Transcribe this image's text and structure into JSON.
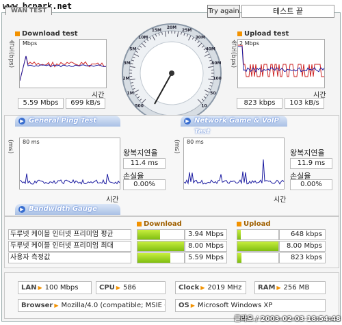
{
  "header": {
    "watermark": "www.bcpark.net",
    "wan_tab": "WAN TEST",
    "try_again": "Try again",
    "status": "테스트 끝"
  },
  "download": {
    "title": "Download test",
    "ylabel": "속도(bps)",
    "scale": "Mbps",
    "xlabel": "시간",
    "value1": "5.59 Mbps",
    "value2": "699 kB/s"
  },
  "upload": {
    "title": "Upload test",
    "ylabel": "속도(bps)",
    "scale": "2 Mbps",
    "xlabel": "시간",
    "value1": "823 kbps",
    "value2": "103 kB/s"
  },
  "gauge": {
    "ticks": [
      "500",
      "1M",
      "2M",
      "3M",
      "5M",
      "10M",
      "15M",
      "20M",
      "25M",
      "30M",
      "40M",
      "50M",
      "100",
      "50",
      "10"
    ],
    "needle_value": "5.59 Mbps"
  },
  "ping": {
    "bar_label": "General Ping Test",
    "ylabel": "(ms)",
    "scale": "80 ms",
    "xlabel": "시간",
    "rtt_label": "왕복지연율",
    "rtt_value": "11.4 ms",
    "loss_label": "손실율",
    "loss_value": "0.00%"
  },
  "game": {
    "bar_label": "Network Game & VoIP Test",
    "ylabel": "(ms)",
    "scale": "80 ms",
    "xlabel": "시간",
    "rtt_label": "왕복지연율",
    "rtt_value": "11.9 ms",
    "loss_label": "손실율",
    "loss_value": "0.00%"
  },
  "bandwidth": {
    "bar_label": "Bandwidth Gauge",
    "download_header": "Download",
    "upload_header": "Upload",
    "rows": [
      {
        "label": "두루넷 케이블 인터넷 프리미엄 평균",
        "dl_value": "3.94 Mbps",
        "dl_frac": 0.49,
        "ul_value": "648 kbps",
        "ul_frac": 0.08
      },
      {
        "label": "두루넷 케이블 인터넷 프리미엄 최대",
        "dl_value": "8.00 Mbps",
        "dl_frac": 1.0,
        "ul_value": "8.00 Mbps",
        "ul_frac": 1.0
      },
      {
        "label": "사용자 측정값",
        "dl_value": "5.59 Mbps",
        "dl_frac": 0.7,
        "ul_value": "823 kbps",
        "ul_frac": 0.1
      }
    ]
  },
  "system": {
    "lan_label": "LAN",
    "lan_value": "100 Mbps",
    "cpu_label": "CPU",
    "cpu_value": "586",
    "clock_label": "Clock",
    "clock_value": "2019 MHz",
    "ram_label": "RAM",
    "ram_value": "256 MB",
    "browser_label": "Browser",
    "browser_value": "Mozilla/4.0 (compatible; MSIE 6.0",
    "os_label": "OS",
    "os_value": "Microsoft Windows XP"
  },
  "footer": {
    "timestamp": "클라오 / 2003-02-03 18:54:48"
  },
  "colors": {
    "accent": "#f39200",
    "download_line": "#cc2222",
    "upload_line": "#1a1aa0",
    "bar_fill": "#8fd11a"
  }
}
